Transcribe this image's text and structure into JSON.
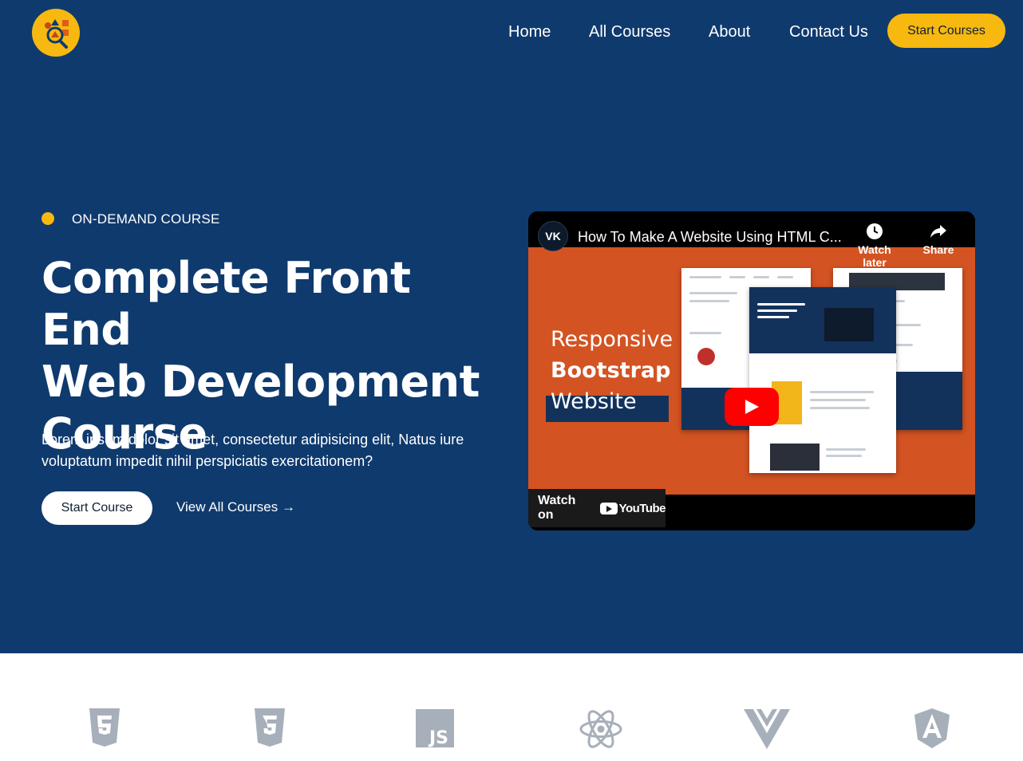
{
  "header": {
    "nav": [
      "Home",
      "All Courses",
      "About",
      "Contact Us"
    ],
    "cta_label": "Start Courses"
  },
  "hero": {
    "eyebrow": "ON-DEMAND COURSE",
    "title_lines": [
      "Complete Front End",
      "Web Development",
      "Course"
    ],
    "description": "Lorem ipsum dolor sit amet, consectetur adipisicing elit, Natus iure voluptatum impedit nihil perspiciatis exercitationem?",
    "primary_button": "Start Course",
    "secondary_link": "View All Courses →"
  },
  "video": {
    "title": "How To Make A Website Using HTML C...",
    "watch_later": "Watch later",
    "share": "Share",
    "thumbnail_lines": [
      "Responsive",
      "Bootstrap",
      "Website"
    ],
    "watch_on": "Watch on",
    "youtube": "YouTube",
    "channel_initials": "VK"
  },
  "tech_logos": [
    "html5-icon",
    "css3-icon",
    "js-icon",
    "react-icon",
    "vue-icon",
    "angular-icon"
  ],
  "colors": {
    "hero_bg": "#0f3a6e",
    "accent": "#f7b90f",
    "thumb_bg": "#d35322",
    "logo_gray": "#a7afba"
  }
}
